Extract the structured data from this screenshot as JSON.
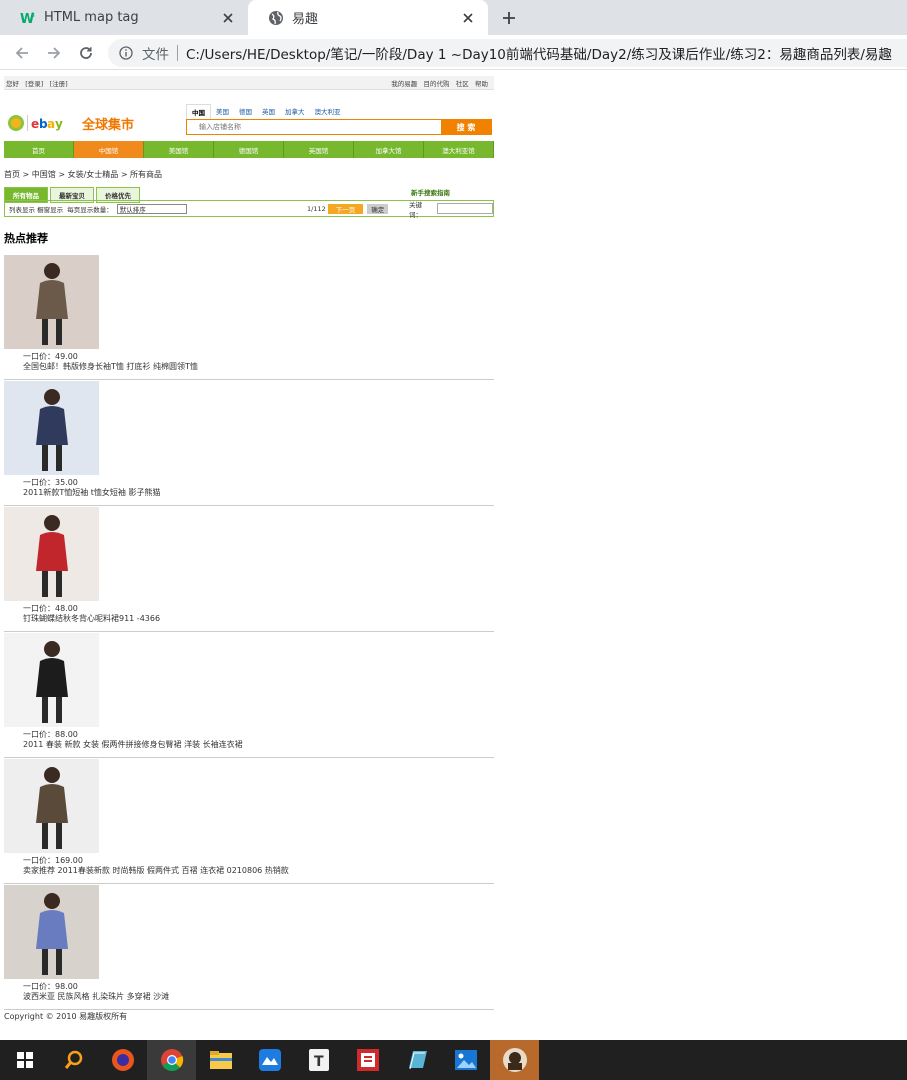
{
  "browser": {
    "tabs": [
      {
        "title": "HTML map tag",
        "icon": "w3schools-icon"
      },
      {
        "title": "易趣",
        "icon": "globe-icon"
      }
    ],
    "address": {
      "file_label": "文件",
      "url": "C:/Users/HE/Desktop/笔记/一阶段/Day 1 ~Day10前端代码基础/Day2/练习及课后作业/练习2：易趣商品列表/易趣"
    }
  },
  "site": {
    "topbar": {
      "left": [
        "您好",
        "[登录]",
        "[注册]"
      ],
      "right": [
        "我的易趣",
        "目的代购",
        "社区",
        "帮助"
      ]
    },
    "logo_text": "全球集市",
    "search": {
      "tabs": [
        "中国",
        "美国",
        "德国",
        "英国",
        "加拿大",
        "澳大利亚"
      ],
      "placeholder": "输入店铺名称",
      "button": "搜 索"
    },
    "nav": [
      "首页",
      "中国馆",
      "美国馆",
      "德国馆",
      "英国馆",
      "加拿大馆",
      "澳大利亚馆"
    ],
    "breadcrumb": "首页 > 中国馆 > 女装/女士精品 > 所有商品",
    "filter": {
      "tabs": [
        "所有物品",
        "最新宝贝",
        "价格优先"
      ],
      "guide": "新手搜索指南",
      "view_list": "列表显示",
      "view_grid": "橱窗显示",
      "per_page": "每页显示数量：",
      "sort_default": "默认排序",
      "page_info": "1/112",
      "next": "下一页",
      "confirm": "确定",
      "keyword": "关键词："
    },
    "hot_title": "热点推荐",
    "products": [
      {
        "price": "一口价：49.00",
        "name": "全国包邮！韩版修身长袖T恤 打底衫 纯棉圆领T恤",
        "img_colors": [
          "#6b5a4a",
          "#d9cfc8"
        ]
      },
      {
        "price": "一口价：35.00",
        "name": "2011新款T恤短袖 t恤女短袖 影子熊猫",
        "img_colors": [
          "#2f3a5c",
          "#dfe6ef"
        ]
      },
      {
        "price": "一口价：48.00",
        "name": "钉珠蝴蝶结秋冬背心呢料裙911 -4366",
        "img_colors": [
          "#c0262b",
          "#efe9e6"
        ]
      },
      {
        "price": "一口价：88.00",
        "name": "2011 春装 新款 女装 假两件拼接修身包臀裙 洋装 长袖连衣裙",
        "img_colors": [
          "#1c1c1c",
          "#f3f3f3"
        ]
      },
      {
        "price": "一口价：169.00",
        "name": "卖家推荐 2011春装新款 时尚韩版 假两件式 百褶 连衣裙 0210806 热销款",
        "img_colors": [
          "#5a4a3a",
          "#eeeeee"
        ]
      },
      {
        "price": "一口价：98.00",
        "name": "波西米亚 民族风格 扎染珠片 多穿裙 沙滩",
        "img_colors": [
          "#6a7cc0",
          "#d8d2cc"
        ]
      }
    ],
    "copyright": "Copyright © 2010 易趣版权所有"
  }
}
